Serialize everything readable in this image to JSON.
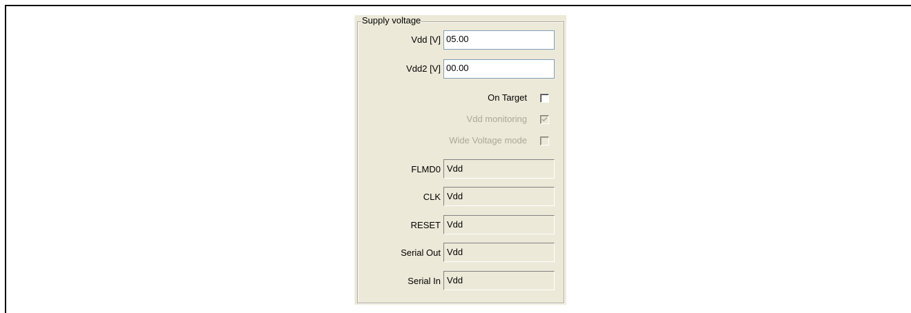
{
  "group": {
    "title": "Supply voltage"
  },
  "fields": {
    "vdd": {
      "label": "Vdd [V]",
      "value": "05.00"
    },
    "vdd2": {
      "label": "Vdd2 [V]",
      "value": "00.00"
    }
  },
  "checkboxes": {
    "on_target": {
      "label": "On Target",
      "checked": false,
      "enabled": true
    },
    "vdd_monitoring": {
      "label": "Vdd monitoring",
      "checked": true,
      "enabled": false
    },
    "wide_voltage": {
      "label": "Wide Voltage mode",
      "checked": false,
      "enabled": false
    }
  },
  "pins": {
    "flmd0": {
      "label": "FLMD0",
      "value": "Vdd"
    },
    "clk": {
      "label": "CLK",
      "value": "Vdd"
    },
    "reset": {
      "label": "RESET",
      "value": "Vdd"
    },
    "serial_out": {
      "label": "Serial Out",
      "value": "Vdd"
    },
    "serial_in": {
      "label": "Serial In",
      "value": "Vdd"
    }
  },
  "colors": {
    "dialog_bg": "#ece9d8",
    "disabled_text": "#aca899",
    "edit_border": "#7f9db9"
  }
}
